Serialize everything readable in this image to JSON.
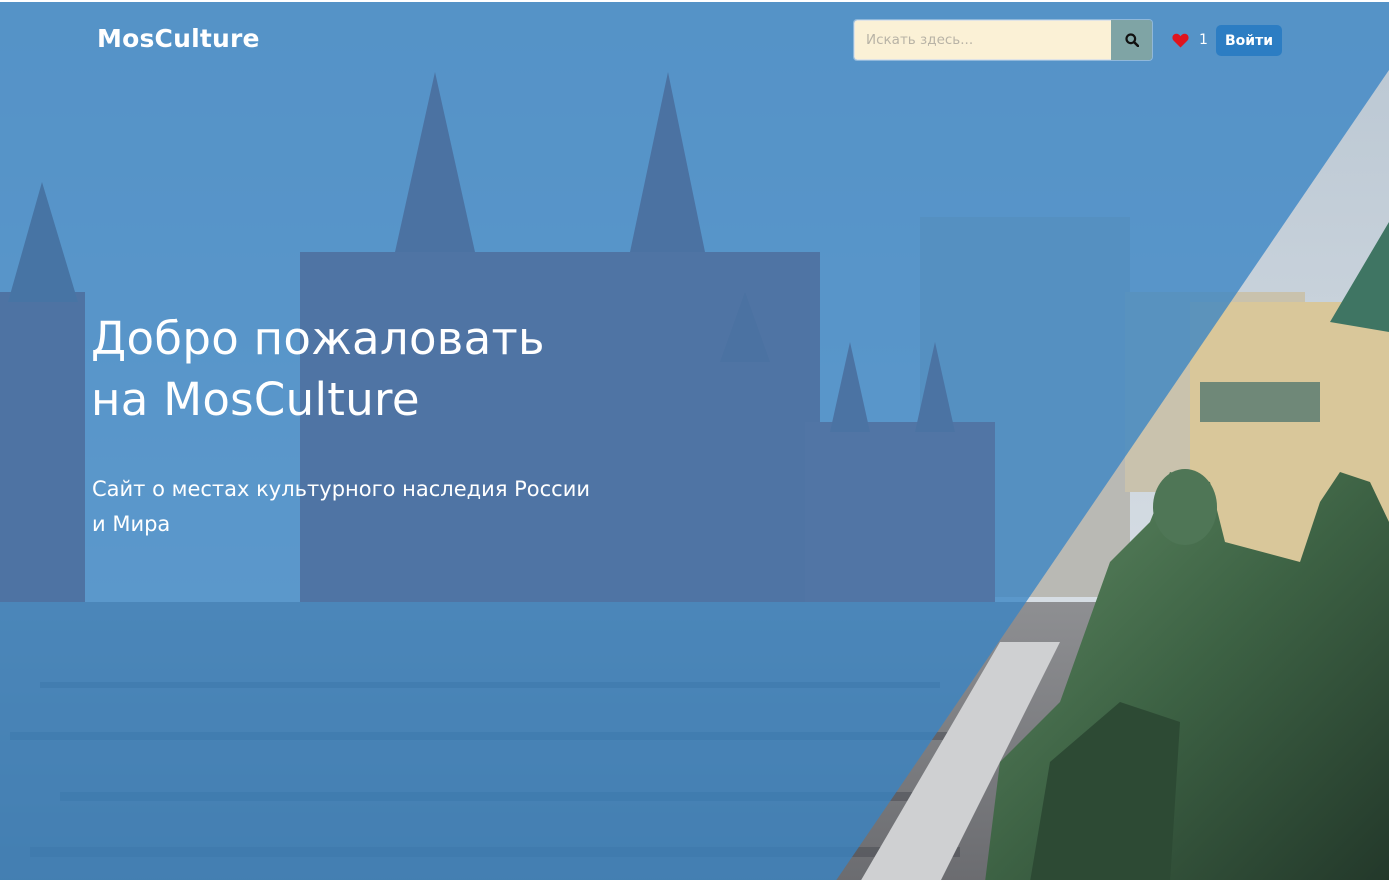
{
  "header": {
    "brand": "MosCulture",
    "search": {
      "placeholder": "Искать здесь...",
      "value": "",
      "button_icon": "search-icon"
    },
    "favorites": {
      "icon": "heart-icon",
      "count": "1"
    },
    "login_label": "Войти"
  },
  "hero": {
    "title_line1": "Добро пожаловать",
    "title_line2": "на MosCulture",
    "subtitle_line1": "Сайт о местах культурного наследия России",
    "subtitle_line2": "и Мира"
  },
  "colors": {
    "overlay": "#3884c4",
    "login_button": "#2c7dc3",
    "search_input_bg": "#fbf1d6",
    "search_button_bg": "#7fa4a5",
    "heart": "#e0141e"
  }
}
